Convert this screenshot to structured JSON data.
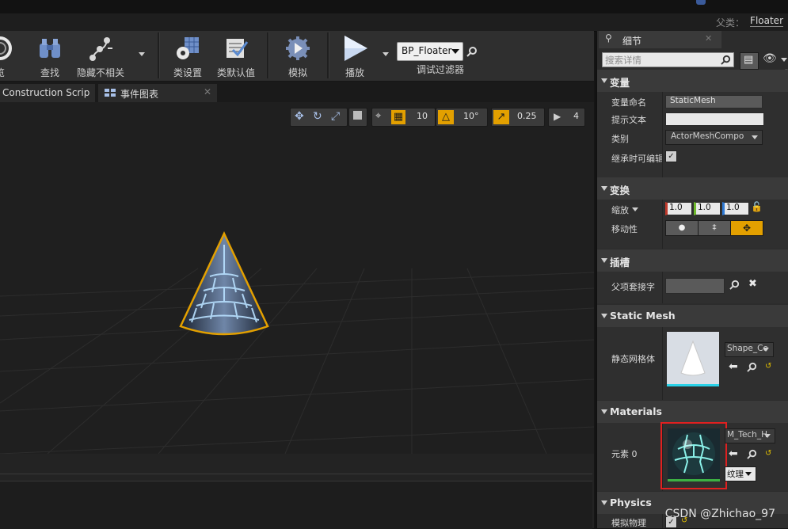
{
  "header": {
    "parent_label": "父类：",
    "parent_value": "Floater"
  },
  "toolbar": {
    "items": [
      {
        "label": "览"
      },
      {
        "label": "查找"
      },
      {
        "label": "隐藏不相关"
      },
      {
        "label": "类设置"
      },
      {
        "label": "类默认值"
      },
      {
        "label": "模拟"
      },
      {
        "label": "播放"
      }
    ],
    "debug_select_value": "BP_Floater",
    "debug_filter_label": "调试过滤器"
  },
  "tabs": [
    {
      "label": "Construction Scrip"
    },
    {
      "label": "事件图表"
    }
  ],
  "viewport": {
    "grid_snap": "10",
    "rot_snap": "10°",
    "scale_snap": "0.25",
    "cam_speed": "4"
  },
  "details": {
    "tab_title": "细节",
    "search_placeholder": "搜索详情",
    "sections": {
      "variable": "变量",
      "transform": "变换",
      "socket": "插槽",
      "static_mesh": "Static Mesh",
      "materials": "Materials",
      "physics": "Physics"
    },
    "rows": {
      "var_name_label": "变量命名",
      "var_name_value": "StaticMesh",
      "tooltip_label": "提示文本",
      "tooltip_value": "",
      "category_label": "类别",
      "category_value": "ActorMeshCompo",
      "inherit_label": "继承时可编辑",
      "scale_label": "缩放",
      "scale_x": "1.0",
      "scale_y": "1.0",
      "scale_z": "1.0",
      "mobility_label": "移动性",
      "parent_socket_label": "父项套接字",
      "mesh_label": "静态网格体",
      "mesh_value": "Shape_Co",
      "element_label": "元素 0",
      "material_value": "M_Tech_H",
      "texture_label": "纹理",
      "sim_physics_label": "模拟物理"
    }
  },
  "watermark": "CSDN @Zhichao_97",
  "colors": {
    "accent_orange": "#e3a000",
    "selection_red": "#e02020",
    "axis_x": "#c0392b",
    "axis_y": "#6fba2c",
    "axis_z": "#2f7bd6"
  }
}
